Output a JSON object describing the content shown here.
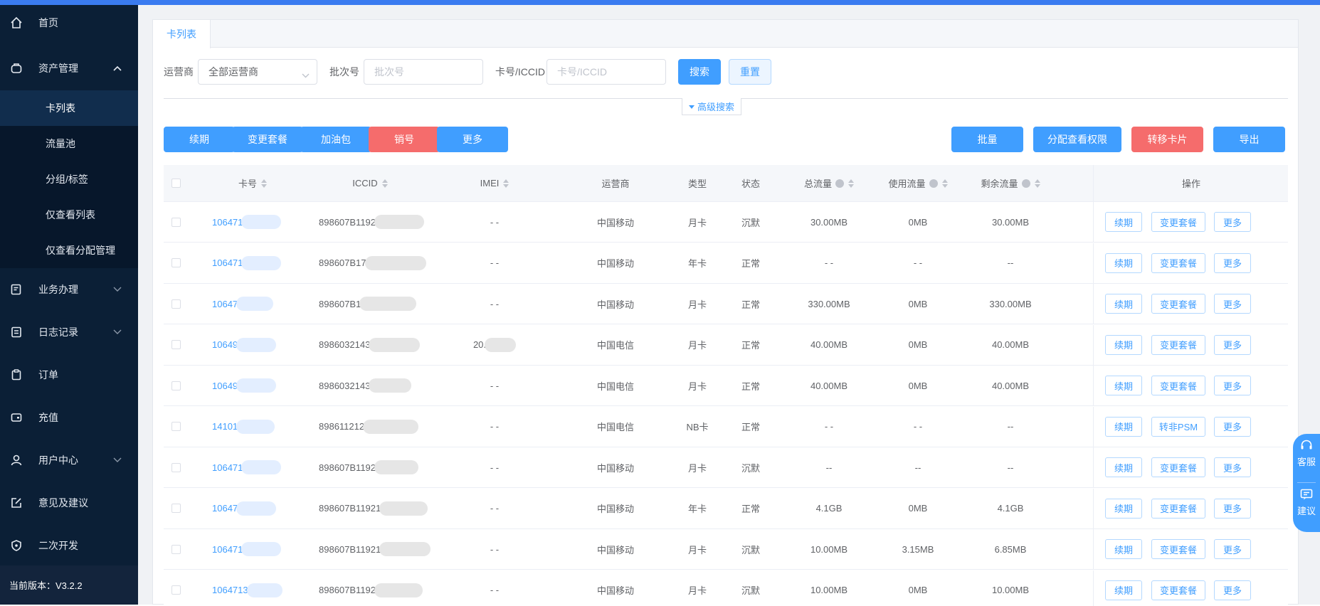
{
  "sidebar": {
    "items": [
      {
        "label": "首页",
        "icon": "home-icon"
      },
      {
        "label": "资产管理",
        "icon": "wallet-icon"
      },
      {
        "label": "业务办理",
        "icon": "form-icon"
      },
      {
        "label": "日志记录",
        "icon": "log-icon"
      },
      {
        "label": "订单",
        "icon": "clipboard-icon"
      },
      {
        "label": "充值",
        "icon": "card-icon"
      },
      {
        "label": "用户中心",
        "icon": "user-icon"
      },
      {
        "label": "意见及建议",
        "icon": "edit-icon"
      },
      {
        "label": "二次开发",
        "icon": "shield-icon"
      }
    ],
    "sub": [
      "卡列表",
      "流量池",
      "分组/标签",
      "仅查看列表",
      "仅查看分配管理"
    ],
    "version": "当前版本：V3.2.2"
  },
  "tab": "卡列表",
  "filters": {
    "operator_label": "运营商",
    "operator_value": "全部运营商",
    "batch_label": "批次号",
    "batch_placeholder": "批次号",
    "iccid_label": "卡号/ICCID",
    "iccid_placeholder": "卡号/ICCID",
    "search": "搜索",
    "reset": "重置",
    "advanced": "高级搜索"
  },
  "actions": {
    "renew": "续期",
    "change_plan": "变更套餐",
    "addon": "加油包",
    "cancel": "销号",
    "more": "更多",
    "batch": "批量",
    "assign": "分配查看权限",
    "transfer": "转移卡片",
    "export": "导出"
  },
  "table": {
    "headers": {
      "card": "卡号",
      "iccid": "ICCID",
      "imei": "IMEI",
      "operator": "运营商",
      "type": "类型",
      "status": "状态",
      "total": "总流量",
      "used": "使用流量",
      "remaining": "剩余流量",
      "ops": "操作"
    },
    "rows": [
      {
        "card": "106471",
        "iccid": "898607B1192",
        "imei": "- -",
        "operator": "中国移动",
        "type": "月卡",
        "status": "沉默",
        "total": "30.00MB",
        "used": "0MB",
        "remaining": "30.00MB",
        "op2": "变更套餐"
      },
      {
        "card": "106471",
        "iccid": "898607B17",
        "imei": "- -",
        "operator": "中国移动",
        "type": "年卡",
        "status": "正常",
        "total": "- -",
        "used": "- -",
        "remaining": "--",
        "op2": "变更套餐"
      },
      {
        "card": "10647",
        "iccid": "898607B1",
        "imei": "- -",
        "operator": "中国移动",
        "type": "月卡",
        "status": "正常",
        "total": "330.00MB",
        "used": "0MB",
        "remaining": "330.00MB",
        "op2": "变更套餐"
      },
      {
        "card": "10649",
        "iccid": "8986032143",
        "imei": "20.",
        "operator": "中国电信",
        "type": "月卡",
        "status": "正常",
        "total": "40.00MB",
        "used": "0MB",
        "remaining": "40.00MB",
        "op2": "变更套餐"
      },
      {
        "card": "10649",
        "iccid": "8986032143",
        "imei": "- -",
        "operator": "中国电信",
        "type": "月卡",
        "status": "正常",
        "total": "40.00MB",
        "used": "0MB",
        "remaining": "40.00MB",
        "op2": "变更套餐"
      },
      {
        "card": "14101",
        "iccid": "898611212",
        "imei": "- -",
        "operator": "中国电信",
        "type": "NB卡",
        "status": "正常",
        "total": "- -",
        "used": "- -",
        "remaining": "--",
        "op2": "转非PSM"
      },
      {
        "card": "106471",
        "iccid": "898607B1192",
        "imei": "- -",
        "operator": "中国移动",
        "type": "月卡",
        "status": "沉默",
        "total": "--",
        "used": "--",
        "remaining": "--",
        "op2": "变更套餐"
      },
      {
        "card": "10647",
        "iccid": "898607B11921",
        "imei": "- -",
        "operator": "中国移动",
        "type": "年卡",
        "status": "正常",
        "total": "4.1GB",
        "used": "0MB",
        "remaining": "4.1GB",
        "op2": "变更套餐"
      },
      {
        "card": "106471",
        "iccid": "898607B11921",
        "imei": "- -",
        "operator": "中国移动",
        "type": "月卡",
        "status": "沉默",
        "total": "10.00MB",
        "used": "3.15MB",
        "remaining": "6.85MB",
        "op2": "变更套餐"
      },
      {
        "card": "1064713",
        "iccid": "898607B1192",
        "imei": "- -",
        "operator": "中国移动",
        "type": "月卡",
        "status": "沉默",
        "total": "10.00MB",
        "used": "0MB",
        "remaining": "10.00MB",
        "op2": "变更套餐"
      }
    ],
    "row_op1": "续期",
    "row_op3": "更多"
  },
  "float": {
    "service": "客服",
    "suggest": "建议"
  }
}
